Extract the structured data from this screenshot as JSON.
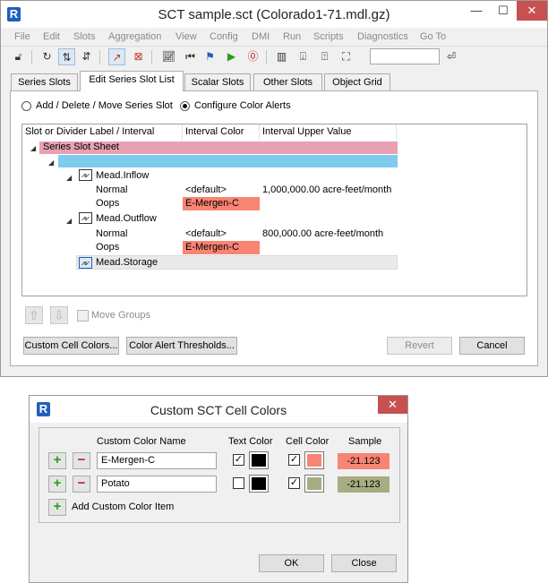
{
  "main_window": {
    "title": "SCT sample.sct (Colorado1-71.mdl.gz)",
    "window_controls": {
      "minimize": "—",
      "maximize": "☐",
      "close": "✕"
    },
    "menu": [
      "File",
      "Edit",
      "Slots",
      "Aggregation",
      "View",
      "Config",
      "DMI",
      "Run",
      "Scripts",
      "Diagnostics",
      "Go To"
    ],
    "toolbar_search_value": ""
  },
  "tabs": [
    "Series Slots",
    "Edit Series Slot List",
    "Scalar Slots",
    "Other Slots",
    "Object Grid"
  ],
  "active_tab": "Edit Series Slot List",
  "mode_options": {
    "add_delete_move": "Add / Delete / Move Series Slot",
    "configure_alerts": "Configure Color Alerts",
    "selected": "configure_alerts"
  },
  "tree": {
    "columns": [
      "Slot or Divider Label / Interval",
      "Interval Color",
      "Interval Upper Value"
    ],
    "sheet_label": "Series Slot Sheet",
    "slots": [
      {
        "name": "Mead.Inflow",
        "intervals": [
          {
            "label": "Normal",
            "color": "<default>",
            "upper": "1,000,000.00 acre-feet/month"
          },
          {
            "label": "Oops",
            "color": "E-Mergen-C",
            "upper": ""
          }
        ]
      },
      {
        "name": "Mead.Outflow",
        "intervals": [
          {
            "label": "Normal",
            "color": "<default>",
            "upper": "800,000.00 acre-feet/month"
          },
          {
            "label": "Oops",
            "color": "E-Mergen-C",
            "upper": ""
          }
        ]
      },
      {
        "name": "Mead.Storage",
        "intervals": []
      }
    ]
  },
  "move_groups_label": "Move Groups",
  "buttons": {
    "custom_cell_colors": "Custom Cell Colors...",
    "color_alert_thresholds": "Color Alert Thresholds...",
    "revert": "Revert",
    "cancel": "Cancel"
  },
  "colors": {
    "sheet_row": "#e8a1b0",
    "divider_row": "#7fcbef",
    "emergenc": "#f88474",
    "potato": "#a8ac82",
    "selection": "#eaeaea"
  },
  "dialog": {
    "title": "Custom SCT Cell Colors",
    "close": "✕",
    "headers": {
      "name": "Custom Color Name",
      "text_color": "Text Color",
      "cell_color": "Cell Color",
      "sample": "Sample"
    },
    "items": [
      {
        "name": "E-Mergen-C",
        "text_color_checked": true,
        "text_color": "#000000",
        "cell_color_checked": true,
        "cell_color": "#f88474",
        "sample": "-21.123"
      },
      {
        "name": "Potato",
        "text_color_checked": false,
        "text_color": "#000000",
        "cell_color_checked": true,
        "cell_color": "#a8ac82",
        "sample": "-21.123"
      }
    ],
    "add_item_label": "Add Custom Color Item",
    "ok": "OK",
    "close_button": "Close"
  }
}
